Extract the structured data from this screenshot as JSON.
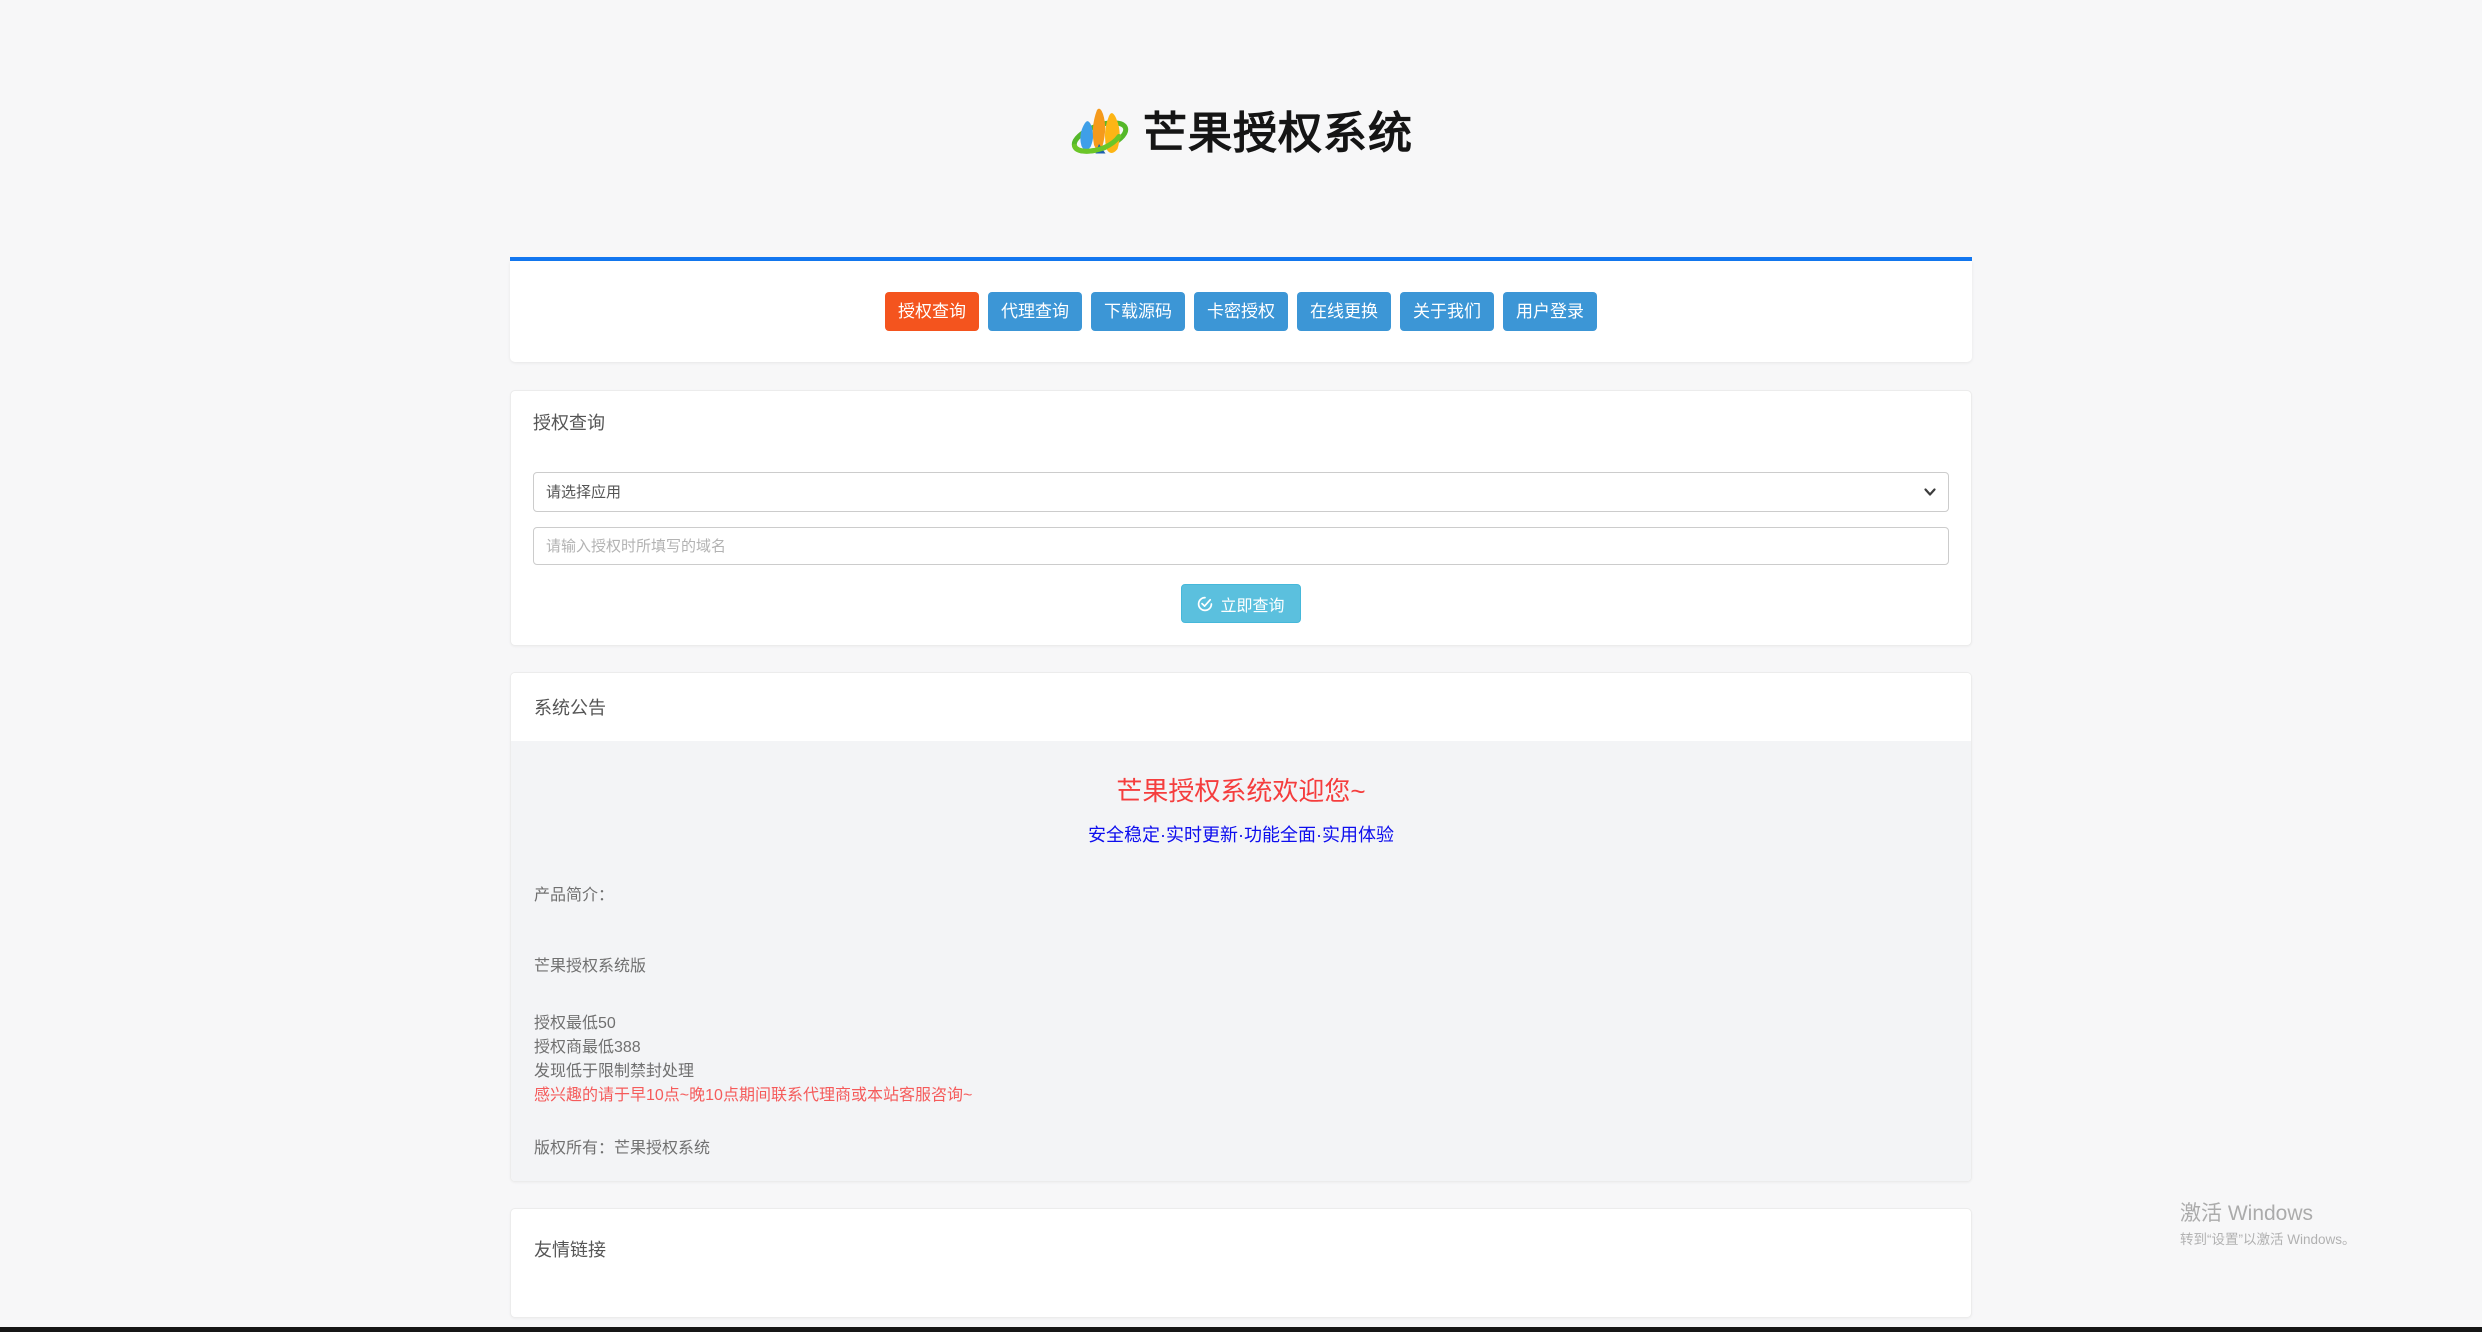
{
  "brand": {
    "title": "芒果授权系统",
    "logo": "mango-logo-icon"
  },
  "nav": {
    "items": [
      {
        "label": "授权查询",
        "active": true
      },
      {
        "label": "代理查询",
        "active": false
      },
      {
        "label": "下载源码",
        "active": false
      },
      {
        "label": "卡密授权",
        "active": false
      },
      {
        "label": "在线更换",
        "active": false
      },
      {
        "label": "关于我们",
        "active": false
      },
      {
        "label": "用户登录",
        "active": false
      }
    ]
  },
  "query": {
    "header": "授权查询",
    "app_select_value": "请选择应用",
    "domain_placeholder": "请输入授权时所填写的域名",
    "submit_label": "立即查询",
    "submit_icon": "check-circle-icon"
  },
  "notice": {
    "header": "系统公告",
    "title": "芒果授权系统欢迎您~",
    "subtitle": "安全稳定·实时更新·功能全面·实用体验",
    "intro_label": "产品简介：",
    "product": "芒果授权系统版",
    "lines": [
      "授权最低50",
      "授权商最低388",
      "发现低于限制禁封处理"
    ],
    "highlight": "感兴趣的请于早10点~晚10点期间联系代理商或本站客服咨询~",
    "copyright": "版权所有：芒果授权系统"
  },
  "links": {
    "header": "友情链接"
  },
  "watermark": {
    "line1": "激活 Windows",
    "line2": "转到“设置”以激活 Windows。"
  },
  "colors": {
    "accent_blue": "#1377f0",
    "nav_blue": "#3c96d6",
    "nav_active_orange": "#f4541e",
    "submit_cyan": "#5bc0de",
    "notice_title_red": "#f53d3d",
    "notice_subtitle_blue": "#0d0dee",
    "highlight_red": "#f55b5b",
    "page_background": "#f7f7f8",
    "footer_bar": "#161616"
  }
}
